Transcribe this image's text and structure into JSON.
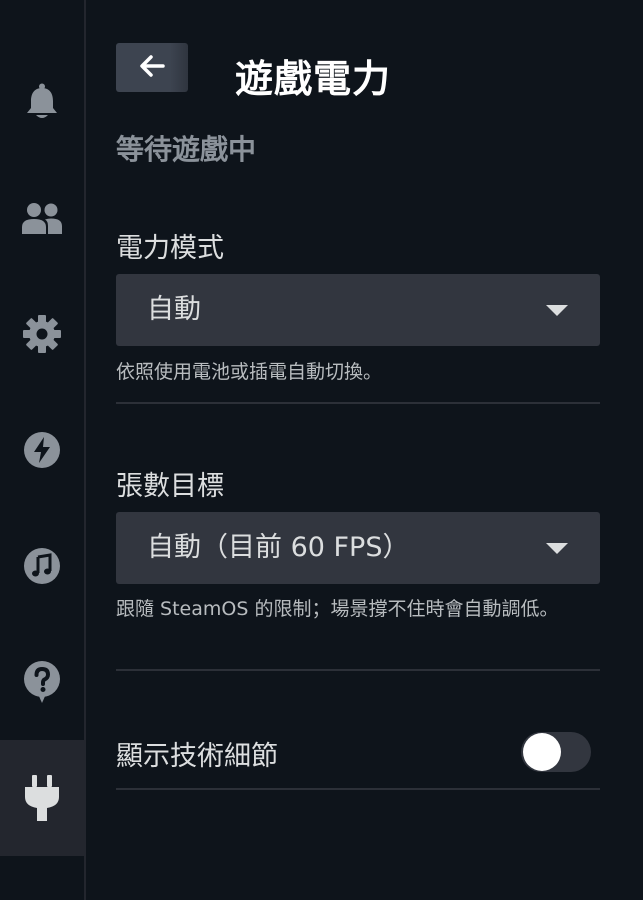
{
  "header": {
    "title": "遊戲電力",
    "back_icon": "arrow-left-icon",
    "status": "等待遊戲中"
  },
  "sidebar": {
    "items": [
      {
        "icon": "bell-icon",
        "active": false
      },
      {
        "icon": "friends-icon",
        "active": false
      },
      {
        "icon": "gear-icon",
        "active": false
      },
      {
        "icon": "lightning-icon",
        "active": false
      },
      {
        "icon": "music-icon",
        "active": false
      },
      {
        "icon": "help-icon",
        "active": false
      },
      {
        "icon": "power-plug-icon",
        "active": true
      }
    ]
  },
  "power_mode": {
    "label": "電力模式",
    "value": "自動",
    "description": "依照使用電池或插電自動切換。"
  },
  "frame_target": {
    "label": "張數目標",
    "value": "自動（目前 60 FPS）",
    "description": "跟隨 SteamOS 的限制；場景撐不住時會自動調低。"
  },
  "technical_details": {
    "label": "顯示技術細節",
    "enabled": false
  },
  "colors": {
    "background": "#0e141b",
    "panel": "#32363f",
    "active_rail": "#23262e",
    "text": "#dcdedf",
    "muted_text": "#8b929a"
  }
}
